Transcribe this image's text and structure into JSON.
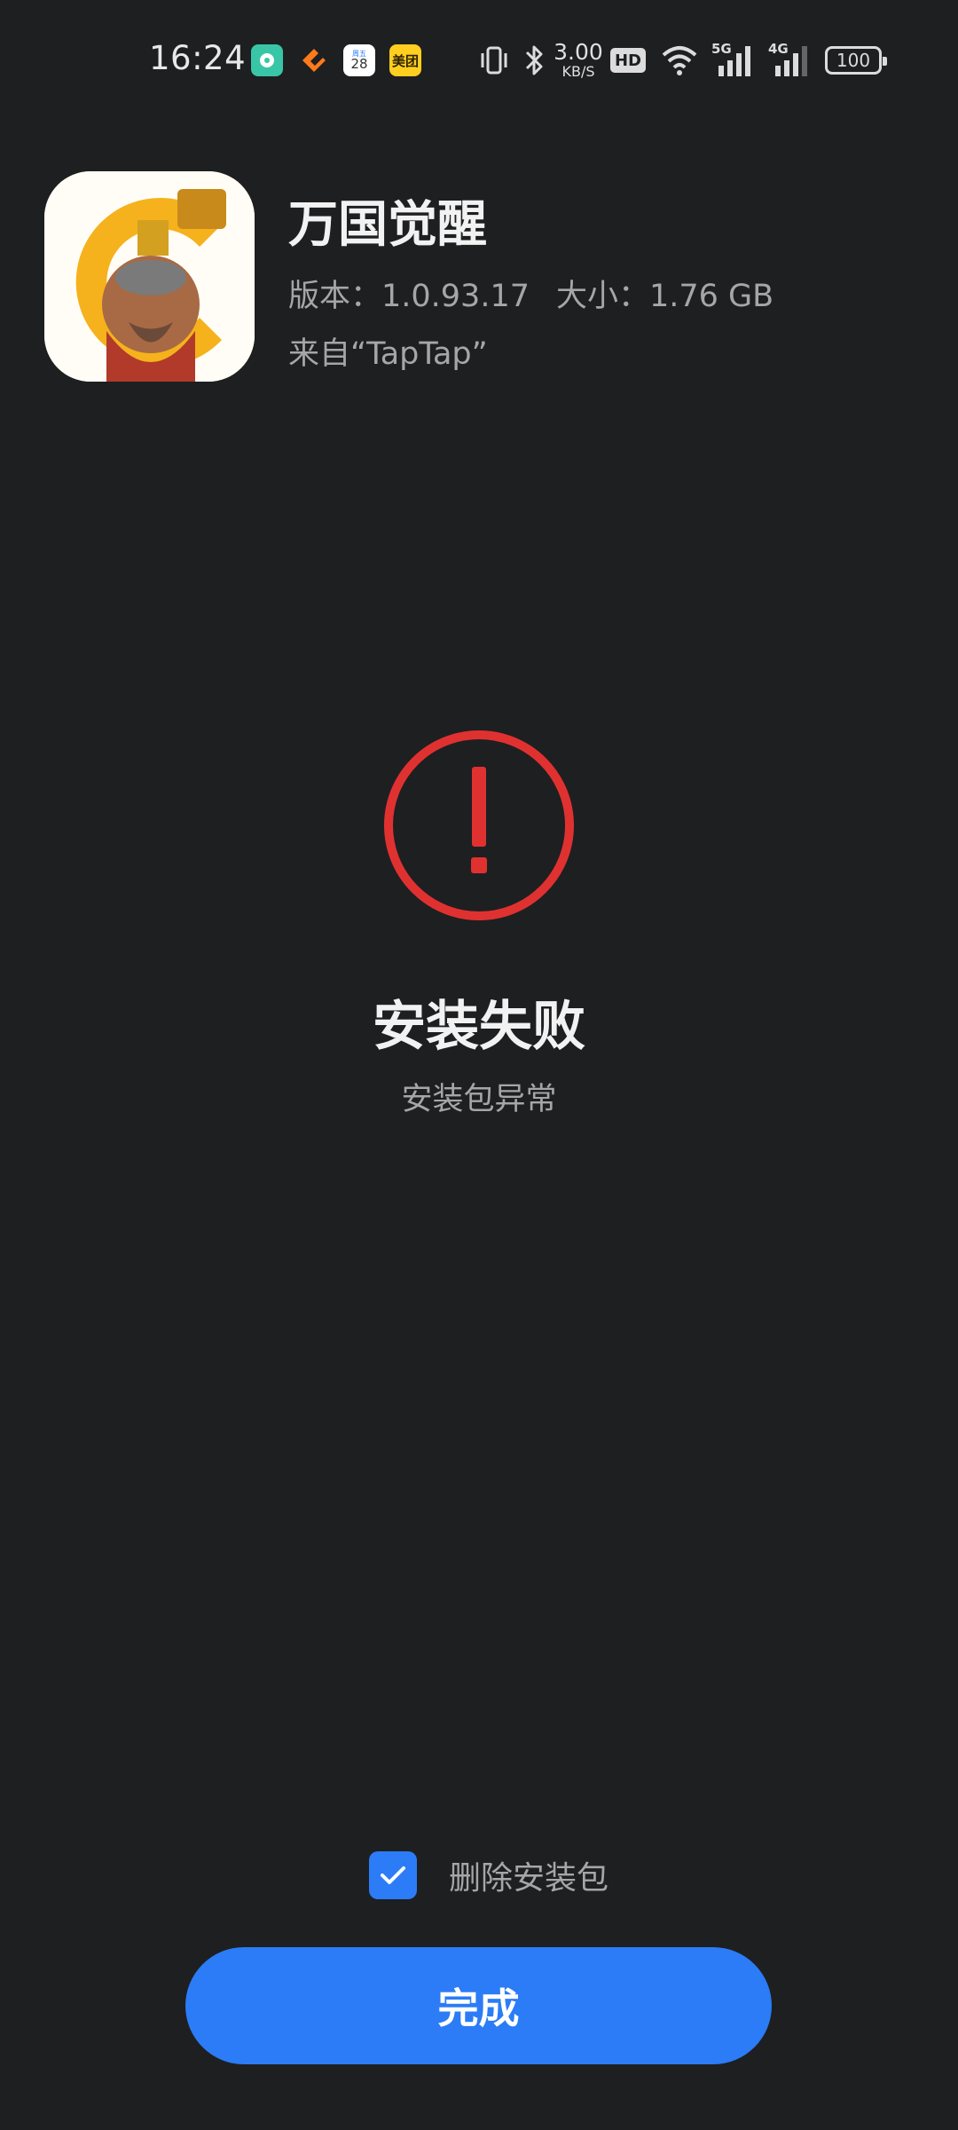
{
  "status_bar": {
    "time": "16:24",
    "calendar_day": "28",
    "meituan_label": "美团",
    "net_speed_value": "3.00",
    "net_speed_unit": "KB/S",
    "hd_label": "HD",
    "signal_1_label": "5G",
    "signal_2_label": "4G",
    "battery_level": "100"
  },
  "app": {
    "name": "万国觉醒",
    "version": "版本：1.0.93.17",
    "size": "大小：1.76 GB",
    "source": "来自“TapTap”",
    "icon": "game-icon"
  },
  "result": {
    "icon": "error-exclamation-icon",
    "title": "安装失败",
    "subtitle": "安装包异常",
    "accent_color": "#e03131"
  },
  "options": {
    "delete_package_label": "删除安装包",
    "delete_package_checked": true
  },
  "actions": {
    "done_label": "完成",
    "primary_color": "#2b7cf6"
  }
}
